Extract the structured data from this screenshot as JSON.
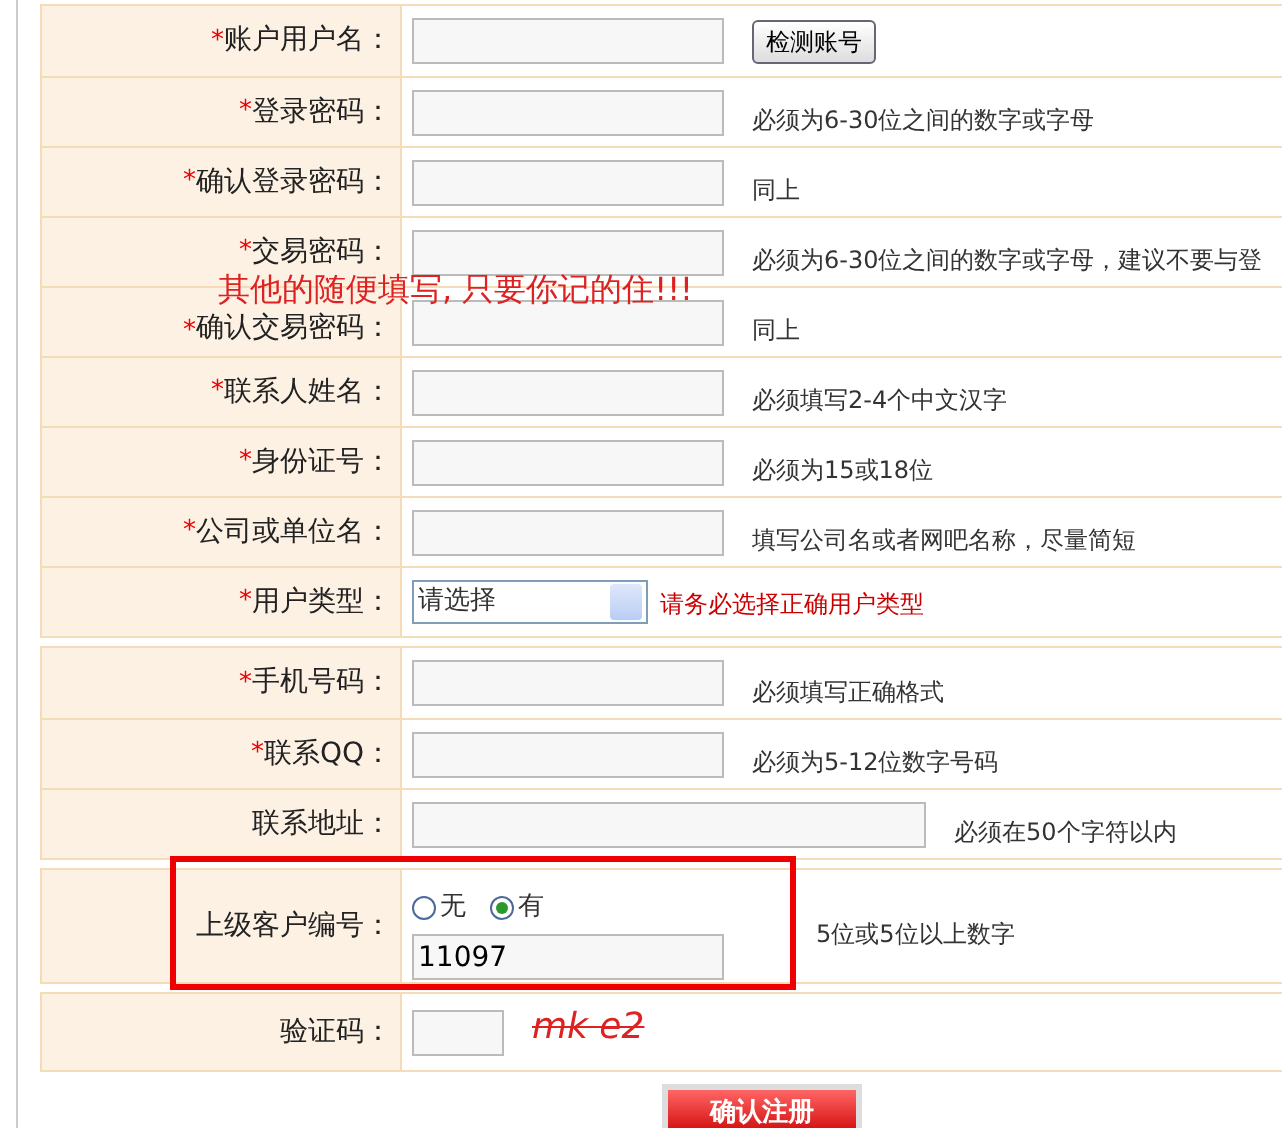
{
  "groups": [
    {
      "rows": [
        {
          "kind": "text",
          "required_mark": "*",
          "label": "账户用户名：",
          "button": "检测账号"
        },
        {
          "kind": "text",
          "required_mark": "*",
          "label": "登录密码：",
          "hint": "必须为6-30位之间的数字或字母"
        },
        {
          "kind": "text",
          "required_mark": "*",
          "label": "确认登录密码：",
          "hint": "同上"
        },
        {
          "kind": "text",
          "required_mark": "*",
          "label": "交易密码：",
          "hint": "必须为6-30位之间的数字或字母，建议不要与登"
        },
        {
          "kind": "text",
          "required_mark": "*",
          "label": "确认交易密码：",
          "hint": "同上"
        },
        {
          "kind": "text",
          "required_mark": "*",
          "label": "联系人姓名：",
          "hint": "必须填写2-4个中文汉字"
        },
        {
          "kind": "text",
          "required_mark": "*",
          "label": "身份证号：",
          "hint": "必须为15或18位"
        },
        {
          "kind": "text",
          "required_mark": "*",
          "label": "公司或单位名：",
          "hint": "填写公司名或者网吧名称，尽量简短"
        },
        {
          "kind": "select",
          "required_mark": "*",
          "label": "用户类型：",
          "value": "请选择",
          "hint": "请务必选择正确用户类型",
          "hint_error": true
        }
      ]
    },
    {
      "rows": [
        {
          "kind": "text",
          "required_mark": "*",
          "label": "手机号码：",
          "hint": "必须填写正确格式"
        },
        {
          "kind": "text",
          "required_mark": "*",
          "label": "联系QQ：",
          "hint": "必须为5-12位数字号码"
        },
        {
          "kind": "long",
          "label": "联系地址：",
          "hint": "必须在50个字符以内"
        }
      ]
    },
    {
      "highlighted": true,
      "rows": [
        {
          "kind": "radio",
          "label": "上级客户编号：",
          "options": [
            {
              "label": "无",
              "selected": false
            },
            {
              "label": "有",
              "selected": true
            }
          ],
          "value": "11097",
          "hint": "5位或5位以上数字"
        }
      ]
    },
    {
      "rows": [
        {
          "kind": "captcha",
          "label": "验证码：",
          "code": "mk e2"
        }
      ]
    }
  ],
  "note": "其他的随便填写, 只要你记的住!!!",
  "submit": "确认注册"
}
